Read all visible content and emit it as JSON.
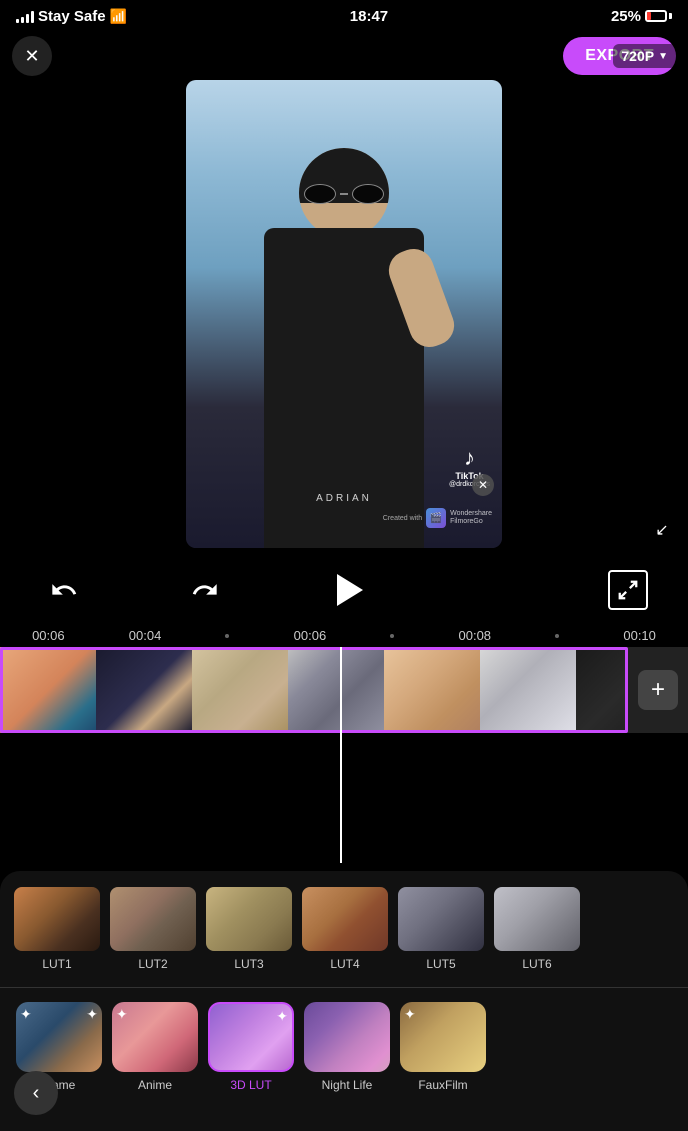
{
  "statusBar": {
    "carrier": "Stay Safe",
    "time": "18:47",
    "battery": "25%",
    "wifi": "wifi"
  },
  "topBar": {
    "closeLabel": "✕",
    "exportLabel": "EXPORT",
    "resolutionLabel": "720\nP"
  },
  "controls": {
    "undoLabel": "↺",
    "redoLabel": "↻",
    "playLabel": "▶"
  },
  "timeline": {
    "markers": [
      "00:06",
      "00:04",
      "00:06",
      "00:08",
      "00:10"
    ]
  },
  "lutRow": {
    "items": [
      {
        "id": "lut1",
        "label": "LUT1"
      },
      {
        "id": "lut2",
        "label": "LUT2"
      },
      {
        "id": "lut3",
        "label": "LUT3"
      },
      {
        "id": "lut4",
        "label": "LUT4"
      },
      {
        "id": "lut5",
        "label": "LUT5"
      },
      {
        "id": "lut6",
        "label": "LUT6"
      }
    ]
  },
  "filterRow": {
    "items": [
      {
        "id": "game",
        "label": "Game",
        "badgeLeft": "✦",
        "badgeRight": "✦",
        "active": false
      },
      {
        "id": "anime",
        "label": "Anime",
        "badgeLeft": "✦",
        "badgeRight": "",
        "active": false
      },
      {
        "id": "3dlut",
        "label": "3D LUT",
        "badgeLeft": "",
        "badgeRight": "✦",
        "active": true
      },
      {
        "id": "nightlife",
        "label": "Night Life",
        "badgeLeft": "",
        "badgeRight": "",
        "active": false
      },
      {
        "id": "fauxfilm",
        "label": "FauxFilm",
        "badgeLeft": "✦",
        "badgeRight": "",
        "active": false
      }
    ]
  },
  "videoOverlay": {
    "nameText": "ADRIAN",
    "watermarkText": "Wondershare\nFilmoreGo",
    "createdWith": "Created with"
  }
}
